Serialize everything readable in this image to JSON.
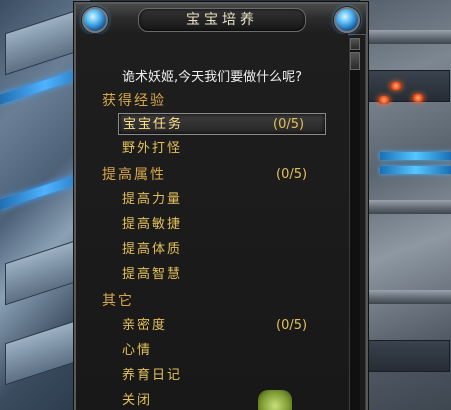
{
  "window": {
    "title": "宝宝培养"
  },
  "dialog": {
    "greeting": "诡术妖姬,今天我们要做什么呢?"
  },
  "menu": {
    "sections": [
      {
        "label": "获得经验",
        "count": "",
        "items": [
          {
            "label": "宝宝任务",
            "count": "(0/5)",
            "selected": true
          },
          {
            "label": "野外打怪",
            "count": "",
            "selected": false
          }
        ]
      },
      {
        "label": "提高属性",
        "count": "(0/5)",
        "items": [
          {
            "label": "提高力量",
            "count": "",
            "selected": false
          },
          {
            "label": "提高敏捷",
            "count": "",
            "selected": false
          },
          {
            "label": "提高体质",
            "count": "",
            "selected": false
          },
          {
            "label": "提高智慧",
            "count": "",
            "selected": false
          }
        ]
      },
      {
        "label": "其它",
        "count": "",
        "items": [
          {
            "label": "亲密度",
            "count": "(0/5)",
            "selected": false
          },
          {
            "label": "心情",
            "count": "",
            "selected": false
          },
          {
            "label": "养育日记",
            "count": "",
            "selected": false
          },
          {
            "label": "关闭",
            "count": "",
            "selected": false
          }
        ]
      }
    ]
  },
  "colors": {
    "section_text": "#d9a84a",
    "item_text": "#e4c15a",
    "greeting_text": "#efefef",
    "title_text": "#e8e0c8"
  },
  "icons": {
    "title_left": "blue-gem-icon",
    "title_right": "blue-gem-icon"
  }
}
